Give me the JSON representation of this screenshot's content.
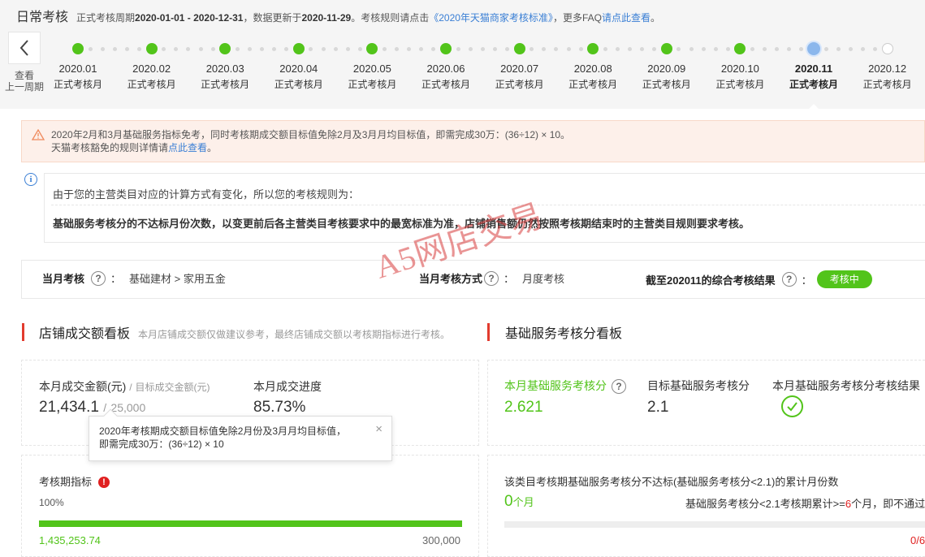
{
  "header": {
    "title": "日常考核",
    "period_prefix": "正式考核周期",
    "period_range": "2020-01-01 - 2020-12-31",
    "update_prefix": "，数据更新于",
    "update_date": "2020-11-29",
    "rule_prefix": "。考核规则请点击",
    "rule_link": "《2020年天猫商家考核标准》",
    "faq_prefix": "，更多FAQ",
    "faq_link": "请点此查看",
    "faq_suffix": "。"
  },
  "timeline": {
    "prev_label_1": "查看",
    "prev_label_2": "上一周期",
    "months": [
      {
        "month": "2020.01",
        "status": "正式考核月",
        "state": "done"
      },
      {
        "month": "2020.02",
        "status": "正式考核月",
        "state": "done"
      },
      {
        "month": "2020.03",
        "status": "正式考核月",
        "state": "done"
      },
      {
        "month": "2020.04",
        "status": "正式考核月",
        "state": "done"
      },
      {
        "month": "2020.05",
        "status": "正式考核月",
        "state": "done"
      },
      {
        "month": "2020.06",
        "status": "正式考核月",
        "state": "done"
      },
      {
        "month": "2020.07",
        "status": "正式考核月",
        "state": "done"
      },
      {
        "month": "2020.08",
        "status": "正式考核月",
        "state": "done"
      },
      {
        "month": "2020.09",
        "status": "正式考核月",
        "state": "done"
      },
      {
        "month": "2020.10",
        "status": "正式考核月",
        "state": "done"
      },
      {
        "month": "2020.11",
        "status": "正式考核月",
        "state": "current"
      },
      {
        "month": "2020.12",
        "status": "正式考核月",
        "state": "future"
      }
    ],
    "colors": {
      "done": "#52c41a",
      "current": "#8bb7ec",
      "future": "#ffffff"
    }
  },
  "warning": {
    "line1": "2020年2月和3月基础服务指标免考，同时考核期成交额目标值免除2月及3月月均目标值，即需完成30万：(36÷12) × 10。",
    "line2_prefix": "天猫考核豁免的规则详情请",
    "line2_link": "点此查看",
    "line2_suffix": "。"
  },
  "rule": {
    "line1": "由于您的主营类目对应的计算方式有变化，所以您的考核规则为：",
    "line2": "基础服务考核分的不达标月份次数，以变更前后各主营类目考核要求中的最宽标准为准，店铺销售额仍然按照考核期结束时的主营类目规则要求考核。"
  },
  "summary": {
    "month_label": "当月考核",
    "colon": "：",
    "month_value": "基础建材 > 家用五金",
    "method_label": "当月考核方式",
    "method_value": "月度考核",
    "result_label": "截至202011的综合考核结果",
    "result_badge": "考核中"
  },
  "watermark": "A5网店交易",
  "sales": {
    "title": "店铺成交额看板",
    "subtitle": "本月店铺成交额仅做建议参考，最终店铺成交额以考核期指标进行考核。",
    "amount_label": "本月成交金额(元)",
    "sep": "/",
    "target_label": "目标成交金额(元)",
    "amount_value": "21,434.1",
    "target_value": "25,000",
    "progress_label": "本月成交进度",
    "progress_value": "85.73%",
    "tooltip_line1": "2020年考核期成交额目标值免除2月份及3月月均目标值，",
    "tooltip_line2": "即需完成30万：(36÷12) × 10",
    "tooltip_close": "×",
    "period_label": "考核期指标",
    "alert_mark": "!",
    "period_percent": "100%",
    "period_progress": 1.0,
    "period_actual": "1,435,253.74",
    "period_target": "300,000"
  },
  "service": {
    "title": "基础服务考核分看板",
    "score_label": "本月基础服务考核分",
    "score_value": "2.621",
    "target_label": "目标基础服务考核分",
    "target_value": "2.1",
    "result_label": "本月基础服务考核分考核结果",
    "result_icon": "check-circle-icon",
    "cumulative_label": "该类目考核期基础服务考核分不达标(基础服务考核分<2.1)的累计月份数",
    "cumulative_value": "0",
    "cumulative_unit": "个月",
    "rule_prefix": "基础服务考核分<2.1考核期累计>=",
    "rule_count": "6",
    "rule_suffix": "个月，即不通过",
    "counter": "0/6"
  },
  "colors": {
    "accent_green": "#52c41a",
    "accent_red": "#e23b2e",
    "link_blue": "#3a7fd5"
  }
}
